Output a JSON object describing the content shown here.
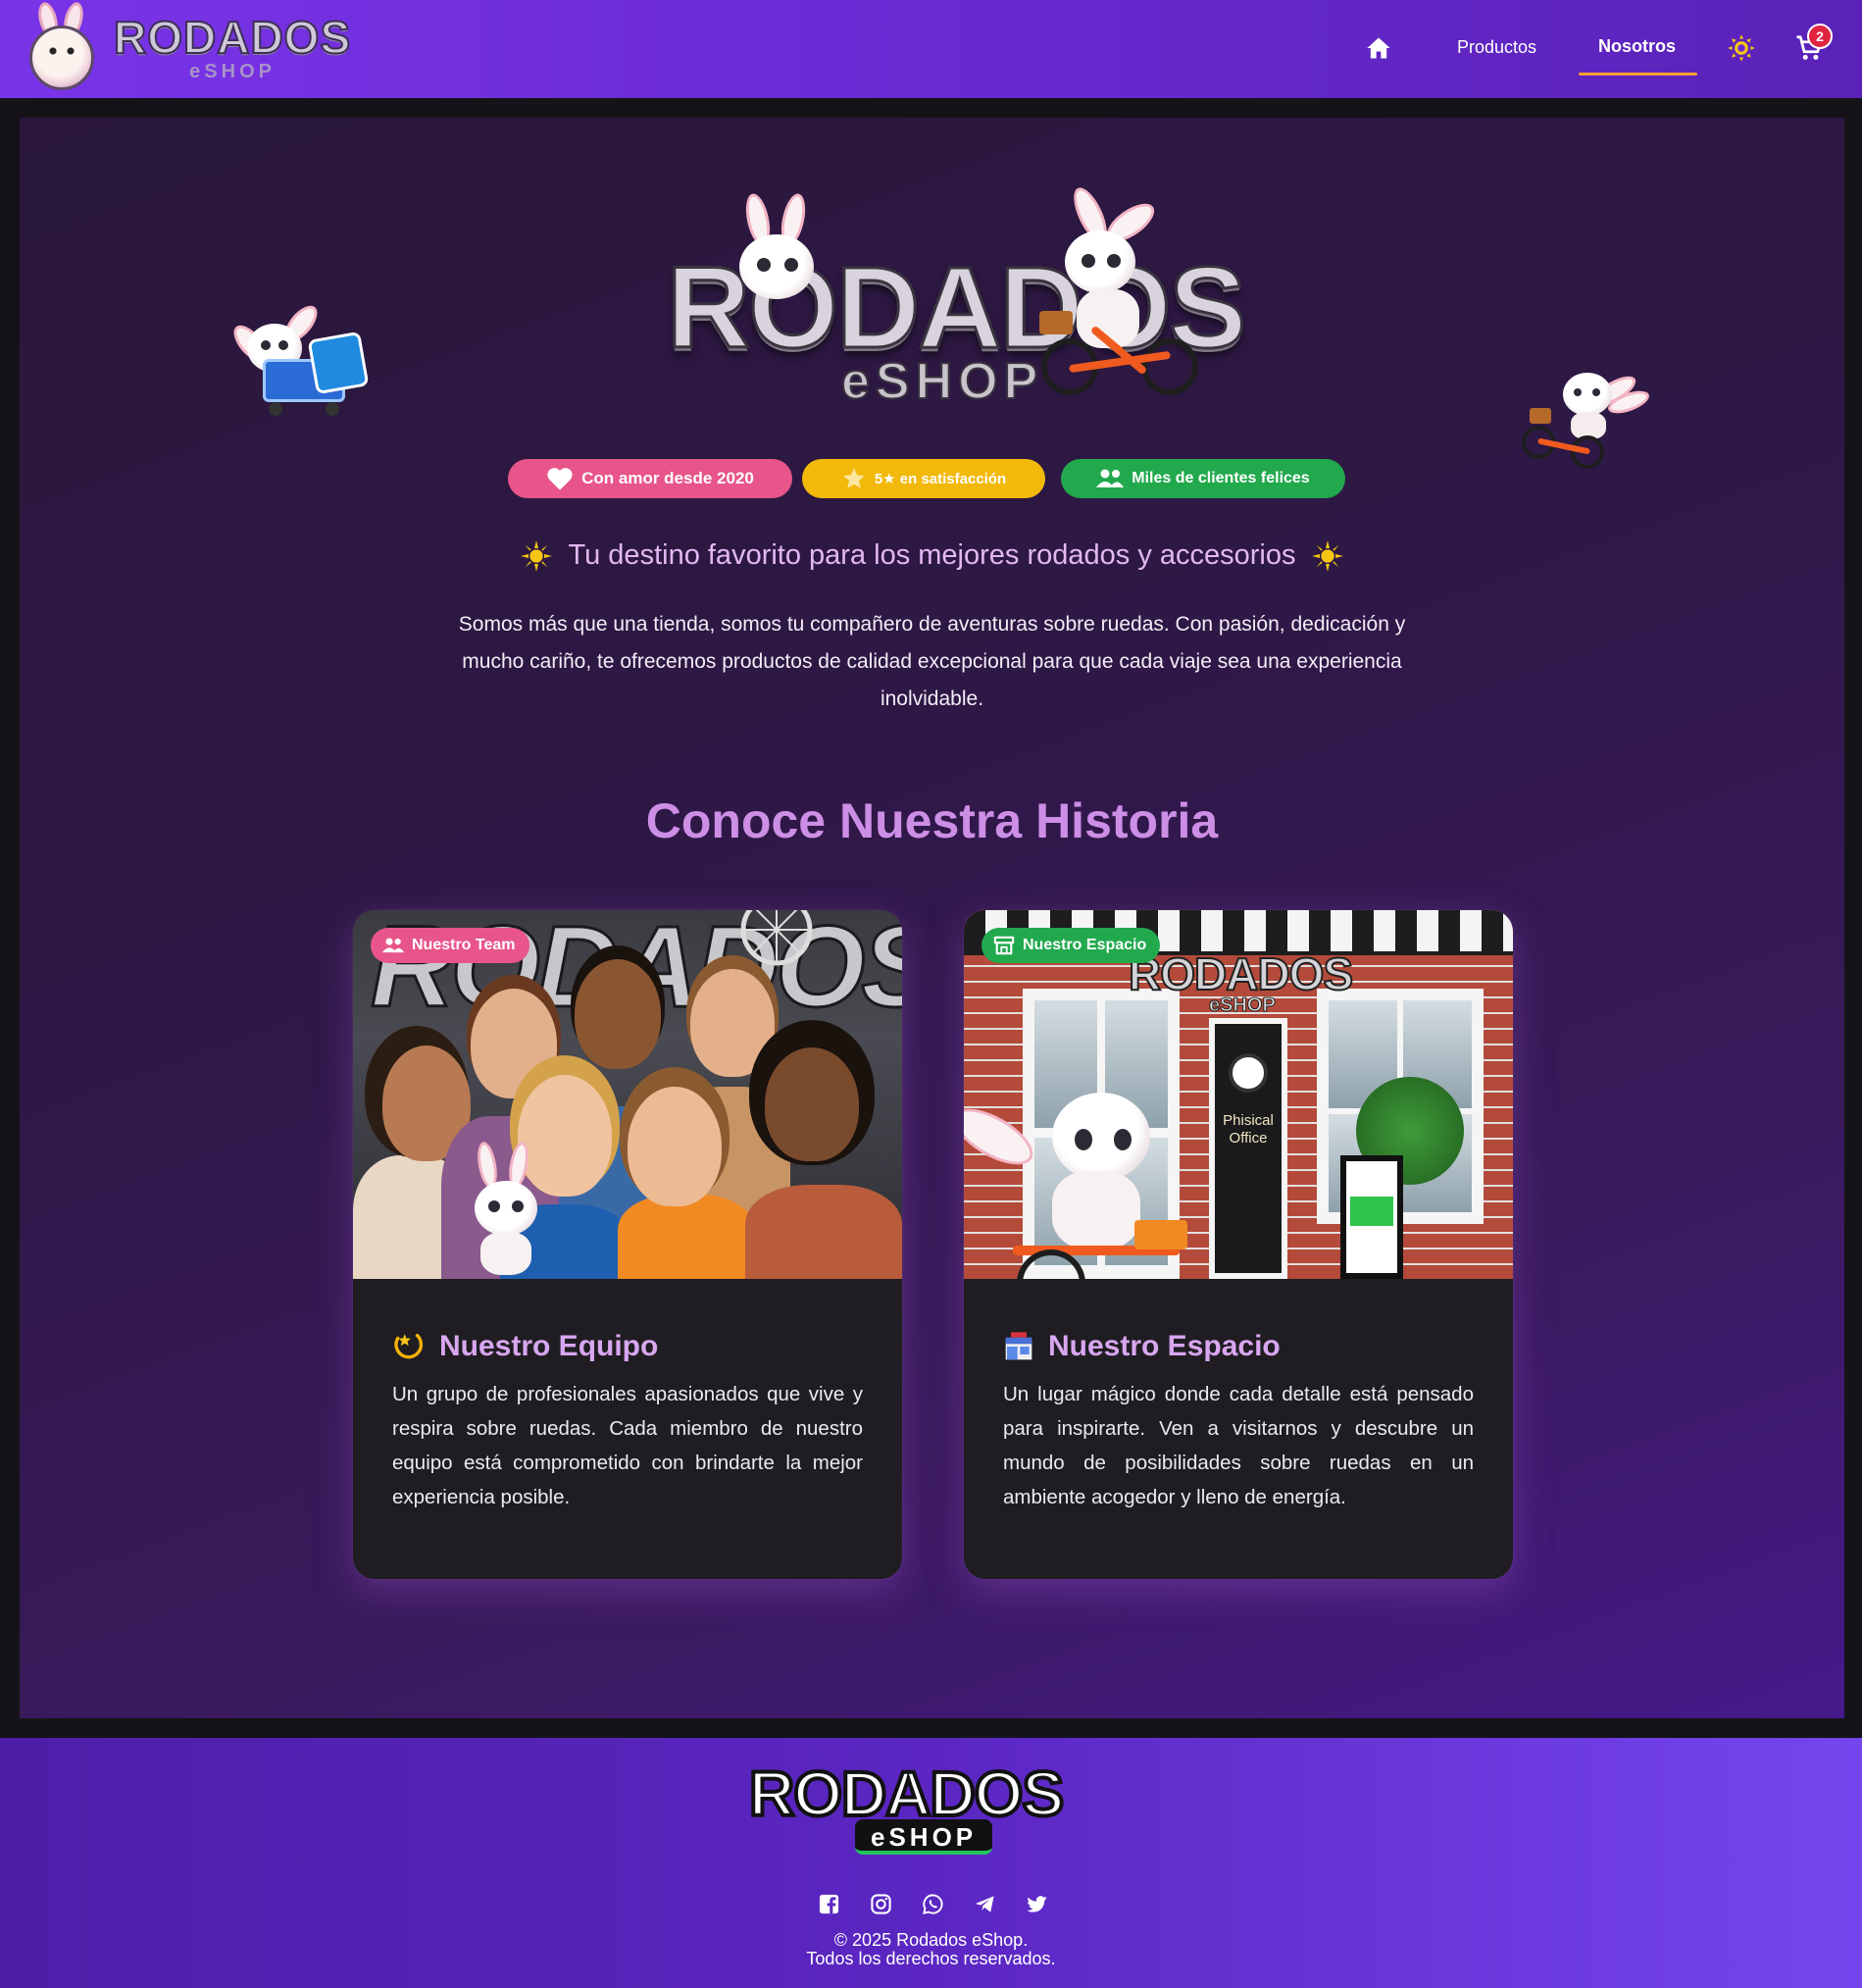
{
  "nav": {
    "brand_title": "RODADOS",
    "brand_subtitle": "eSHOP",
    "links": {
      "productos": "Productos",
      "nosotros": "Nosotros"
    },
    "cart_count": "2",
    "icons": [
      "home-icon",
      "sun-theme-icon",
      "cart-icon"
    ]
  },
  "hero": {
    "logo_title": "RODADOS",
    "logo_subtitle": "eSHOP",
    "badges": [
      {
        "label": "Con amor desde 2020",
        "icon": "heart-icon",
        "color": "#e8558a"
      },
      {
        "label": "5★ en satisfacción",
        "icon": "star-icon",
        "color": "#f2b90a"
      },
      {
        "label": "Miles de clientes felices",
        "icon": "people-icon",
        "color": "#22a94e"
      }
    ],
    "tagline": "Tu destino favorito para los mejores rodados y accesorios",
    "intro": "Somos más que una tienda, somos tu compañero de aventuras sobre ruedas. Con pasión, dedicación y mucho cariño, te ofrecemos productos de calidad excepcional para que cada viaje sea una experiencia inolvidable."
  },
  "history": {
    "title": "Conoce Nuestra Historia",
    "cards": [
      {
        "tag": "Nuestro Team",
        "tag_icon": "people-icon",
        "title": "Nuestro Equipo",
        "title_icon": "dizzy-star-icon",
        "image_sign": "RODADOS",
        "body": "Un grupo de profesionales apasionados que vive y respira sobre ruedas. Cada miembro de nuestro equipo está comprometido con brindarte la mejor experiencia posible."
      },
      {
        "tag": "Nuestro Espacio",
        "tag_icon": "store-icon",
        "title": "Nuestro Espacio",
        "title_icon": "convenience-store-icon",
        "image_sign": "RODADOS",
        "image_sign_sub": "eSHOP",
        "image_door_text": "Phisical Office",
        "body": "Un lugar mágico donde cada detalle está pensado para inspirarte. Ven a visitarnos y descubre un mundo de posibilidades sobre ruedas en un ambiente acogedor y lleno de energía."
      }
    ]
  },
  "footer": {
    "logo_title": "RODADOS",
    "logo_subtitle": "eSHOP",
    "socials": [
      "facebook-icon",
      "instagram-icon",
      "whatsapp-icon",
      "telegram-icon",
      "twitter-icon"
    ],
    "copyright_line1": "© 2025 Rodados eShop.",
    "copyright_line2": "Todos los derechos reservados."
  },
  "colors": {
    "nav": "#6a2bd4",
    "accent_underline": "#f4a233",
    "title_purple": "#cd8ee6",
    "card_bg": "#1f1d22",
    "badge_pink": "#e8558a",
    "badge_yellow": "#f2b90a",
    "badge_green": "#22a94e"
  }
}
